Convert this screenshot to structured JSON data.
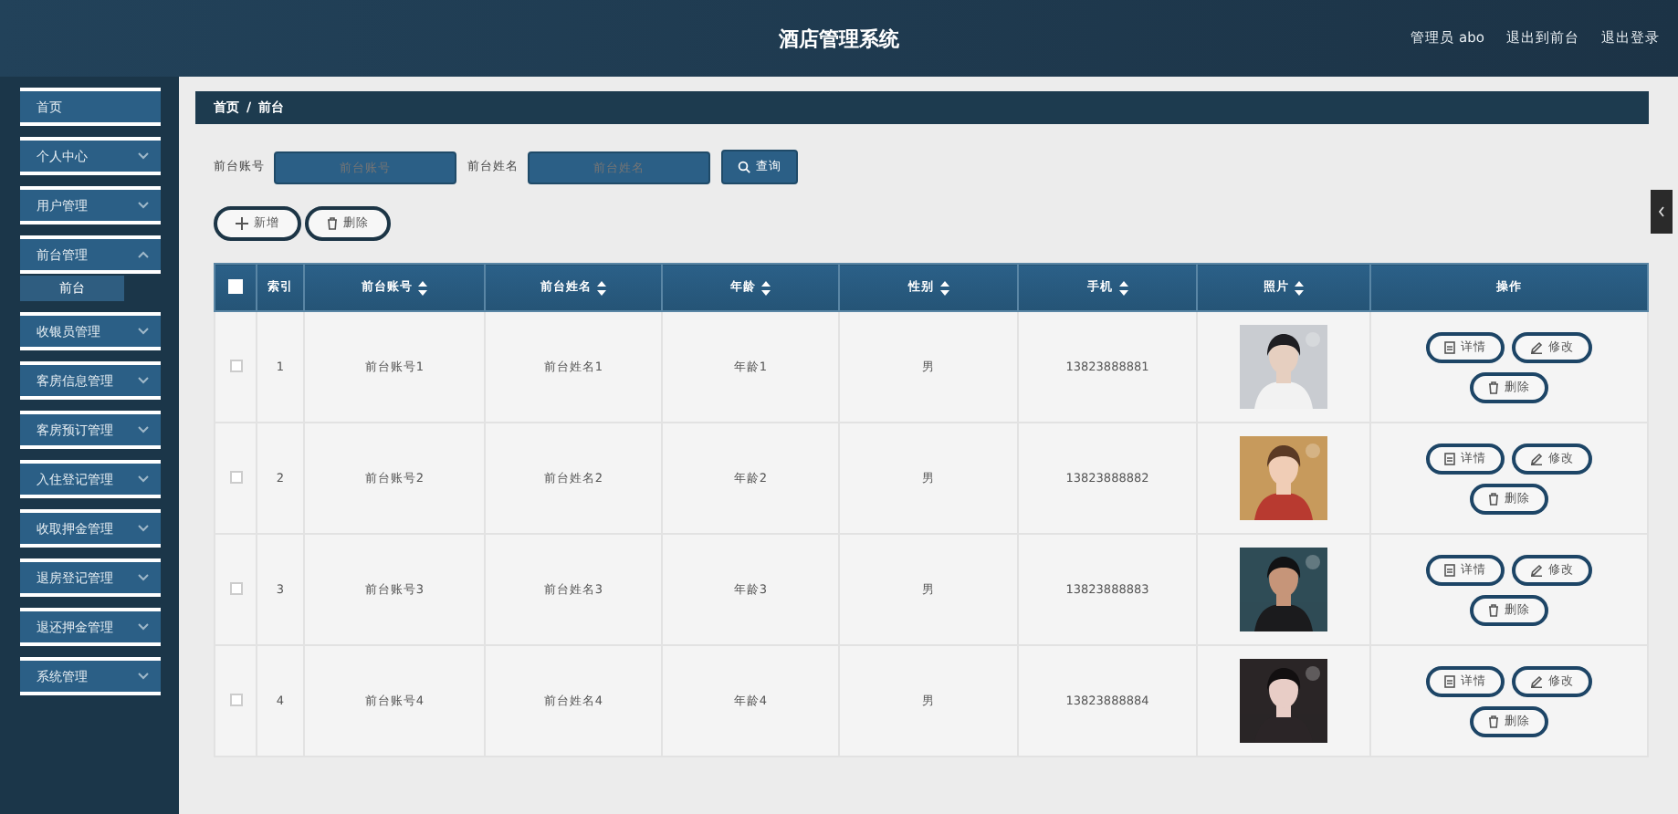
{
  "header": {
    "title": "酒店管理系统",
    "user": "管理员 abo",
    "links": [
      "退出到前台",
      "退出登录"
    ]
  },
  "sidebar": {
    "items": [
      {
        "label": "首页",
        "kind": "link"
      },
      {
        "label": "个人中心",
        "kind": "menu",
        "expanded": false
      },
      {
        "label": "用户管理",
        "kind": "menu",
        "expanded": false
      },
      {
        "label": "前台管理",
        "kind": "menu",
        "expanded": true,
        "children": [
          {
            "label": "前台",
            "selected": true
          }
        ]
      },
      {
        "label": "收银员管理",
        "kind": "menu",
        "expanded": false
      },
      {
        "label": "客房信息管理",
        "kind": "menu",
        "expanded": false
      },
      {
        "label": "客房预订管理",
        "kind": "menu",
        "expanded": false
      },
      {
        "label": "入住登记管理",
        "kind": "menu",
        "expanded": false
      },
      {
        "label": "收取押金管理",
        "kind": "menu",
        "expanded": false
      },
      {
        "label": "退房登记管理",
        "kind": "menu",
        "expanded": false
      },
      {
        "label": "退还押金管理",
        "kind": "menu",
        "expanded": false
      },
      {
        "label": "系统管理",
        "kind": "menu",
        "expanded": false
      }
    ]
  },
  "breadcrumb": {
    "items": [
      "首页",
      "前台"
    ],
    "separator": "/"
  },
  "search": {
    "fields": [
      {
        "label": "前台账号",
        "placeholder": "前台账号"
      },
      {
        "label": "前台姓名",
        "placeholder": "前台姓名"
      }
    ],
    "button": "查询"
  },
  "actions": [
    {
      "label": "新增",
      "kind": "add"
    },
    {
      "label": "删除",
      "kind": "delete"
    }
  ],
  "table": {
    "select_all": {
      "checked": false
    },
    "columns": [
      {
        "label": "索引",
        "sortable": false
      },
      {
        "label": "前台账号",
        "sortable": true
      },
      {
        "label": "前台姓名",
        "sortable": true
      },
      {
        "label": "年龄",
        "sortable": true
      },
      {
        "label": "性别",
        "sortable": true
      },
      {
        "label": "手机",
        "sortable": true
      },
      {
        "label": "照片",
        "sortable": true
      },
      {
        "label": "操作",
        "sortable": false
      }
    ],
    "rows": [
      {
        "checked": false,
        "index": "1",
        "account": "前台账号1",
        "name": "前台姓名1",
        "age": "年龄1",
        "sex": "男",
        "phone": "13823888881",
        "photo": {
          "kind": "picture"
        },
        "buttons": [
          {
            "label": "详情",
            "kind": "detail"
          },
          {
            "label": "修改",
            "kind": "edit"
          },
          {
            "label": "删除",
            "kind": "delete"
          }
        ]
      },
      {
        "checked": false,
        "index": "2",
        "account": "前台账号2",
        "name": "前台姓名2",
        "age": "年龄2",
        "sex": "男",
        "phone": "13823888882",
        "photo": {
          "kind": "picture"
        },
        "buttons": [
          {
            "label": "详情",
            "kind": "detail"
          },
          {
            "label": "修改",
            "kind": "edit"
          },
          {
            "label": "删除",
            "kind": "delete"
          }
        ]
      },
      {
        "checked": false,
        "index": "3",
        "account": "前台账号3",
        "name": "前台姓名3",
        "age": "年龄3",
        "sex": "男",
        "phone": "13823888883",
        "photo": {
          "kind": "picture"
        },
        "buttons": [
          {
            "label": "详情",
            "kind": "detail"
          },
          {
            "label": "修改",
            "kind": "edit"
          },
          {
            "label": "删除",
            "kind": "delete"
          }
        ]
      },
      {
        "checked": false,
        "index": "4",
        "account": "前台账号4",
        "name": "前台姓名4",
        "age": "年龄4",
        "sex": "男",
        "phone": "13823888884",
        "photo": {
          "kind": "picture"
        },
        "buttons": [
          {
            "label": "详情",
            "kind": "detail"
          },
          {
            "label": "修改",
            "kind": "edit"
          },
          {
            "label": "删除",
            "kind": "delete"
          }
        ]
      }
    ]
  }
}
